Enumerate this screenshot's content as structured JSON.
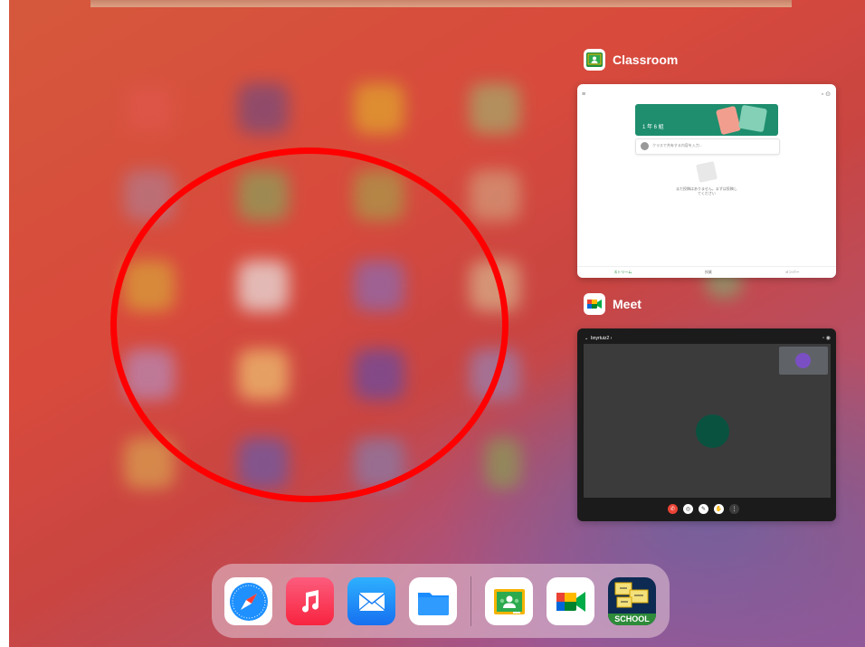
{
  "switcher": {
    "classroom": {
      "label": "Classroom",
      "class_name": "1 年 6 組",
      "post_placeholder": "クラスで共有する内容を入力...",
      "empty_text": "まだ投稿はありません。まずは投稿してください",
      "nav": [
        "ストリーム",
        "授業",
        "メンバー"
      ]
    },
    "meet": {
      "label": "Meet",
      "meeting_code": "bnyrtuiz2 ›"
    }
  },
  "dock": {
    "apps": [
      {
        "name": "Safari",
        "icon": "compass-icon"
      },
      {
        "name": "Music",
        "icon": "music-note-icon"
      },
      {
        "name": "Mail",
        "icon": "envelope-icon"
      },
      {
        "name": "Files",
        "icon": "folder-icon"
      },
      {
        "name": "Classroom",
        "icon": "classroom-icon"
      },
      {
        "name": "Meet",
        "icon": "meet-camera-icon"
      },
      {
        "name": "School",
        "icon": "school-icon",
        "badge_text": "SCHOOL"
      }
    ]
  },
  "colors": {
    "annotation": "#ff0000",
    "classroom_green": "#1e8e6e",
    "meet_dark": "#1b1b1b"
  }
}
